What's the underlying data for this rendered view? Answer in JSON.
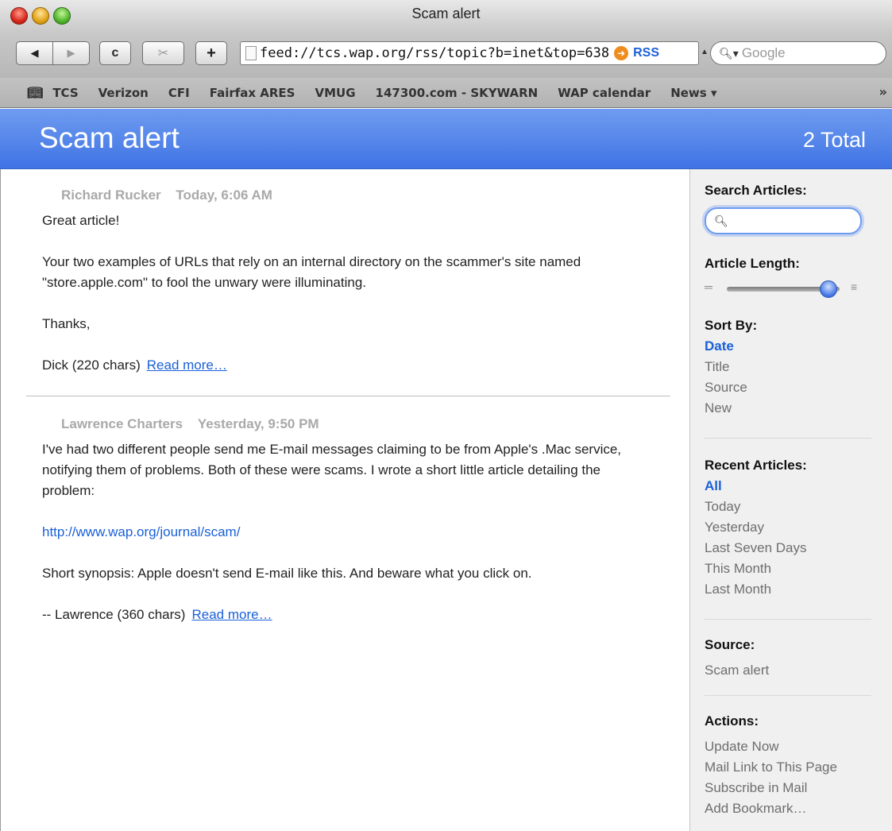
{
  "window": {
    "title": "Scam alert"
  },
  "toolbar": {
    "back_label": "◀",
    "forward_label": "▶",
    "reload_label": "c",
    "snip_label": "✂",
    "add_label": "+",
    "url": "feed://tcs.wap.org/rss/topic?b=inet&top=638",
    "rss_label": "RSS",
    "search_placeholder": "Google"
  },
  "bookmarks": {
    "items": [
      "TCS",
      "Verizon",
      "CFI",
      "Fairfax ARES",
      "VMUG",
      "147300.com - SKYWARN",
      "WAP calendar",
      "News ▾"
    ]
  },
  "header": {
    "title": "Scam alert",
    "total": "2 Total"
  },
  "articles": [
    {
      "author": "Richard Rucker",
      "when": "Today, 6:06 AM",
      "paragraphs": [
        "Great article!",
        "Your two examples of URLs that rely on an internal directory on the scammer's site named \"store.apple.com\" to fool the unwary were illuminating.",
        "Thanks,"
      ],
      "closing": "Dick (220 chars)",
      "read_more": "Read more…"
    },
    {
      "author": "Lawrence Charters",
      "when": "Yesterday, 9:50 PM",
      "paragraphs": [
        "I've had two different people send me E-mail messages claiming to be from Apple's .Mac service, notifying them of problems. Both of these were scams. I wrote a short little article detailing the problem:",
        "Short synopsis: Apple doesn't send E-mail like this. And beware what you click on."
      ],
      "link": "http://www.wap.org/journal/scam/",
      "closing": "-- Lawrence (360 chars)",
      "read_more": "Read more…"
    }
  ],
  "sidebar": {
    "search_heading": "Search Articles:",
    "length_heading": "Article Length:",
    "length_level": 0.9,
    "sort_heading": "Sort By:",
    "sort_options": [
      "Date",
      "Title",
      "Source",
      "New"
    ],
    "recent_heading": "Recent Articles:",
    "recent_options": [
      "All",
      "Today",
      "Yesterday",
      "Last Seven Days",
      "This Month",
      "Last Month"
    ],
    "source_heading": "Source:",
    "source_value": "Scam alert",
    "actions_heading": "Actions:",
    "actions": [
      "Update Now",
      "Mail Link to This Page",
      "Subscribe in Mail",
      "Add Bookmark…"
    ]
  }
}
